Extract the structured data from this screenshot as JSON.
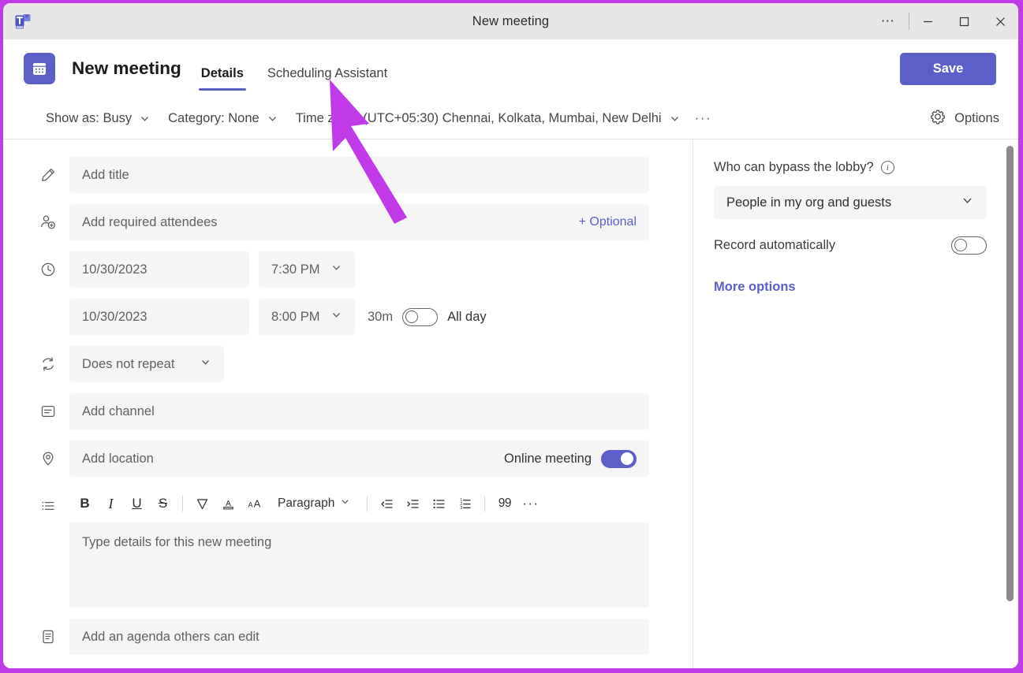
{
  "window": {
    "title": "New meeting",
    "logo_icon": "teams-logo-icon",
    "controls": {
      "more": "⋯",
      "minimize": "minimize-icon",
      "maximize": "maximize-icon",
      "close": "close-icon"
    }
  },
  "header": {
    "calendar_icon": "calendar-icon",
    "title": "New meeting",
    "tabs": [
      {
        "label": "Details",
        "active": true
      },
      {
        "label": "Scheduling Assistant",
        "active": false
      }
    ],
    "save_label": "Save"
  },
  "subbar": {
    "show_as": "Show as: Busy",
    "category": "Category: None",
    "time_zone": "Time zone: (UTC+05:30) Chennai, Kolkata, Mumbai, New Delhi",
    "more": "···",
    "options_label": "Options",
    "options_icon": "gear-icon"
  },
  "form": {
    "title_placeholder": "Add title",
    "title_icon": "pencil-icon",
    "attendees_placeholder": "Add required attendees",
    "attendees_icon": "add-person-icon",
    "optional_label": "+ Optional",
    "clock_icon": "clock-icon",
    "start_date": "10/30/2023",
    "start_time": "7:30 PM",
    "end_date": "10/30/2023",
    "end_time": "8:00 PM",
    "duration": "30m",
    "all_day_label": "All day",
    "all_day_on": false,
    "repeat_icon": "repeat-icon",
    "repeat_value": "Does not repeat",
    "channel_icon": "channel-icon",
    "channel_placeholder": "Add channel",
    "location_icon": "location-pin-icon",
    "location_placeholder": "Add location",
    "online_meeting_label": "Online meeting",
    "online_meeting_on": true,
    "details_icon": "text-description-icon",
    "details_placeholder": "Type details for this new meeting",
    "agenda_icon": "agenda-clipboard-icon",
    "agenda_placeholder": "Add an agenda others can edit"
  },
  "editor_toolbar": {
    "bold": "B",
    "italic": "I",
    "underline": "U",
    "strikethrough": "S",
    "highlight_icon": "highlight-icon",
    "font_color_icon": "font-color-icon",
    "font_size_icon": "font-size-icon",
    "paragraph_label": "Paragraph",
    "decrease_indent_icon": "decrease-indent-icon",
    "increase_indent_icon": "increase-indent-icon",
    "bulleted_list_icon": "bulleted-list-icon",
    "numbered_list_icon": "numbered-list-icon",
    "quote": "99",
    "more": "···"
  },
  "side_panel": {
    "lobby_label": "Who can bypass the lobby?",
    "lobby_info_icon": "info-icon",
    "lobby_value": "People in my org and guests",
    "record_label": "Record automatically",
    "record_on": false,
    "more_options_label": "More options"
  },
  "colors": {
    "accent": "#5b5fc7",
    "annotation": "#c13ae8",
    "titlebar_bg": "#e7e7e7",
    "field_bg": "#f5f5f5"
  }
}
